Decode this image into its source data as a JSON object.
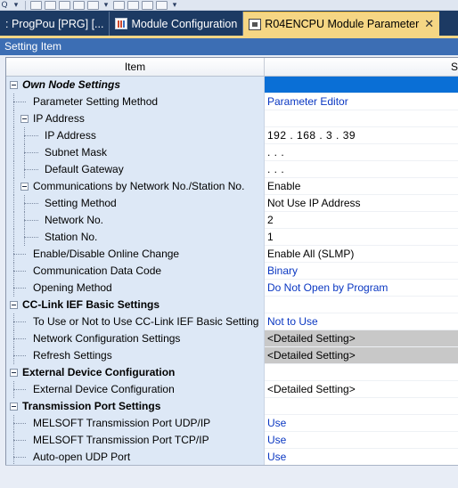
{
  "tabs": [
    {
      "label": ": ProgPou [PRG] [...",
      "active": false,
      "icon": "program-icon"
    },
    {
      "label": "Module Configuration",
      "active": false,
      "icon": "module-config-icon"
    },
    {
      "label": "R04ENCPU Module Parameter",
      "active": true,
      "icon": "cpu-module-icon"
    }
  ],
  "section_header": "Setting Item",
  "columns": {
    "item": "Item",
    "setting": "S"
  },
  "rows": [
    {
      "label": "Own Node Settings",
      "value": "",
      "type": "category-first"
    },
    {
      "label": "Parameter Setting Method",
      "value": "Parameter Editor",
      "style": "blue"
    },
    {
      "label": "IP Address",
      "value": "",
      "type": "group"
    },
    {
      "label": "IP Address",
      "value": "192 . 168 .   3 .  39",
      "style": "ip"
    },
    {
      "label": "Subnet Mask",
      "value": ".     .     .",
      "style": "ip"
    },
    {
      "label": "Default Gateway",
      "value": ".     .     .",
      "style": "ip"
    },
    {
      "label": "Communications by Network No./Station No.",
      "value": "Enable",
      "type": "group"
    },
    {
      "label": "Setting Method",
      "value": "Not Use IP Address"
    },
    {
      "label": "Network No.",
      "value": "2"
    },
    {
      "label": "Station No.",
      "value": "1"
    },
    {
      "label": "Enable/Disable Online Change",
      "value": "Enable All (SLMP)"
    },
    {
      "label": "Communication Data Code",
      "value": "Binary",
      "style": "blue"
    },
    {
      "label": "Opening Method",
      "value": "Do Not Open by Program",
      "style": "blue"
    },
    {
      "label": "CC-Link IEF Basic Settings",
      "value": "",
      "type": "category"
    },
    {
      "label": "To Use or Not to Use CC-Link IEF Basic Setting",
      "value": "Not to Use",
      "style": "blue"
    },
    {
      "label": "Network Configuration Settings",
      "value": "<Detailed Setting>",
      "style": "gray"
    },
    {
      "label": "Refresh Settings",
      "value": "<Detailed Setting>",
      "style": "gray"
    },
    {
      "label": "External Device Configuration",
      "value": "",
      "type": "category"
    },
    {
      "label": "External Device Configuration",
      "value": "<Detailed Setting>"
    },
    {
      "label": "Transmission Port Settings",
      "value": "",
      "type": "category"
    },
    {
      "label": "MELSOFT Transmission Port UDP/IP",
      "value": "Use",
      "style": "blue"
    },
    {
      "label": "MELSOFT Transmission Port TCP/IP",
      "value": "Use",
      "style": "blue"
    },
    {
      "label": "Auto-open UDP Port",
      "value": "Use",
      "style": "blue"
    }
  ],
  "colors": {
    "title_bar": "#1c3a63",
    "active_tab": "#f5d684",
    "header_bar": "#3c6eb4",
    "value_blue": "#0a37c2",
    "item_column": "#dde8f6"
  }
}
